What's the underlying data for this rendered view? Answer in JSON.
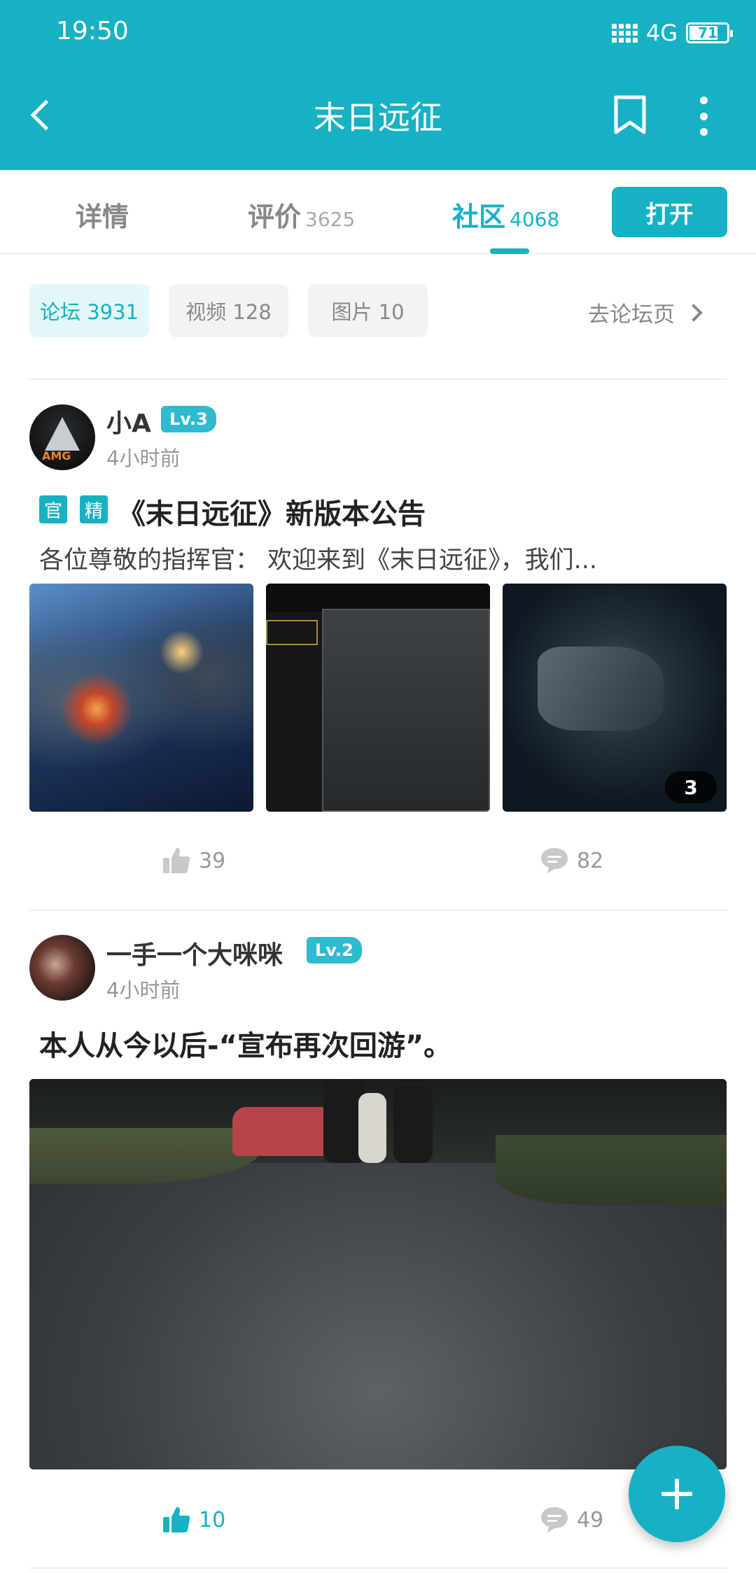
{
  "status_bar": {
    "time": "19:50",
    "network": "4G",
    "battery": "71"
  },
  "header": {
    "title": "末日远征"
  },
  "tabs": [
    {
      "label": "详情",
      "count": ""
    },
    {
      "label": "评价",
      "count": "3625"
    },
    {
      "label": "社区",
      "count": "4068"
    }
  ],
  "open_button": "打开",
  "filters": [
    {
      "label": "论坛 3931"
    },
    {
      "label": "视频 128"
    },
    {
      "label": "图片 10"
    }
  ],
  "forum_link": "去论坛页",
  "posts": [
    {
      "author": "小A",
      "level": "Lv.3",
      "time": "4小时前",
      "tags": [
        "官",
        "精"
      ],
      "title": "《末日远征》新版本公告",
      "excerpt": "各位尊敬的指挥官：        欢迎来到《末日远征》，我们...",
      "image_more_count": "3",
      "likes": "39",
      "comments": "82"
    },
    {
      "author": "一手一个大咪咪",
      "level": "Lv.2",
      "time": "4小时前",
      "title": "本人从今以后-“宣布再次回游”。",
      "likes": "10",
      "comments": "49"
    }
  ],
  "colors": {
    "accent": "#17b1c4"
  }
}
